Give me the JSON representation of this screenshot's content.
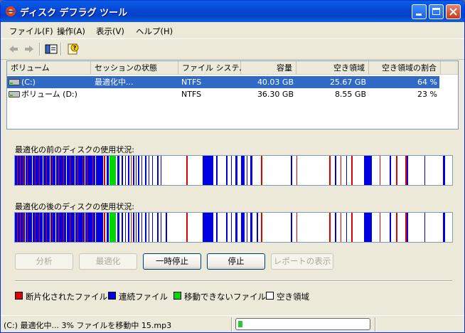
{
  "window": {
    "title": "ディスク デフラグ ツール"
  },
  "menu": [
    "ファイル(F)",
    "操作(A)",
    "表示(V)",
    "ヘルプ(H)"
  ],
  "list": {
    "headers": [
      "ボリューム",
      "セッションの状態",
      "ファイル システム",
      "容量",
      "空き領域",
      "空き領域の割合"
    ],
    "rows": [
      {
        "volume": "(C:)",
        "status": "最適化中...",
        "fs": "NTFS",
        "capacity": "40.03 GB",
        "free": "25.67 GB",
        "pct": "64 %"
      },
      {
        "volume": "ボリューム (D:)",
        "status": "",
        "fs": "NTFS",
        "capacity": "36.30 GB",
        "free": "8.55 GB",
        "pct": "23 %"
      }
    ]
  },
  "analysis": {
    "before_label": "最適化の前のディスクの使用状況:",
    "after_label": "最適化の後のディスクの使用状況:"
  },
  "buttons": {
    "analyze": "分析",
    "defrag": "最適化",
    "pause": "一時停止",
    "stop": "停止",
    "report": "レポートの表示"
  },
  "legend": [
    {
      "label": "断片化されたファイル",
      "color": "#e00000"
    },
    {
      "label": "連続ファイル",
      "color": "#0000e0"
    },
    {
      "label": "移動できないファイル",
      "color": "#00d800"
    },
    {
      "label": "空き領域",
      "color": "#ffffff"
    }
  ],
  "status": {
    "text": "(C:) 最適化中... 3% ファイルを移動中 15.mp3",
    "progress": 0.03
  },
  "colors": {
    "fragmented": "#e00000",
    "contiguous": "#0000e0",
    "unmovable": "#00d800",
    "free": "#ffffff",
    "selection": "#316ac5"
  }
}
